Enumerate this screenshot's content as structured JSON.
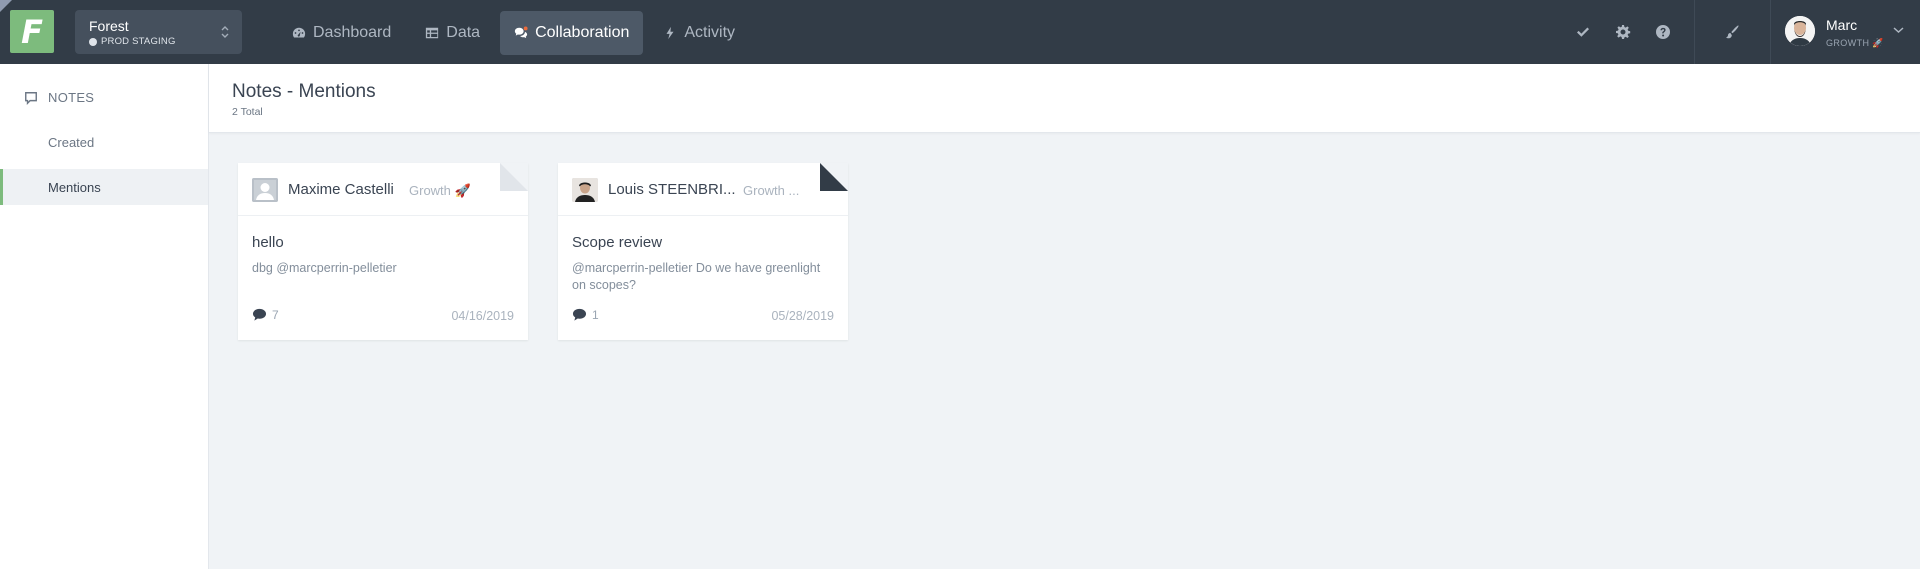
{
  "app": {
    "logo_letter": "F",
    "project_name": "Forest",
    "environment": "PROD STAGING"
  },
  "nav": [
    {
      "label": "Dashboard",
      "icon": "dashboard-icon",
      "active": false
    },
    {
      "label": "Data",
      "icon": "table-icon",
      "active": false
    },
    {
      "label": "Collaboration",
      "icon": "chat-icon",
      "active": true
    },
    {
      "label": "Activity",
      "icon": "bolt-icon",
      "active": false
    }
  ],
  "toolbar_icons": [
    "check-icon",
    "gear-icon",
    "help-icon",
    "brush-icon"
  ],
  "user": {
    "name": "Marc",
    "role": "GROWTH 🚀"
  },
  "sidebar": {
    "heading": "NOTES",
    "items": [
      {
        "label": "Created",
        "active": false
      },
      {
        "label": "Mentions",
        "active": true
      }
    ]
  },
  "page": {
    "title": "Notes - Mentions",
    "subtitle": "2 Total"
  },
  "notes": [
    {
      "author": "Maxime Castelli",
      "team": "Growth 🚀",
      "title": "hello",
      "body": "dbg @marcperrin-pelletier",
      "comments": "7",
      "date": "04/16/2019"
    },
    {
      "author": "Louis STEENBRI...",
      "team": "Growth ...",
      "title": "Scope review",
      "body": "@marcperrin-pelletier Do we have greenlight on scopes?",
      "comments": "1",
      "date": "05/28/2019"
    }
  ],
  "colors": {
    "topbar": "#323c47",
    "accent_green": "#7dbb7d",
    "background": "#f0f3f6"
  }
}
